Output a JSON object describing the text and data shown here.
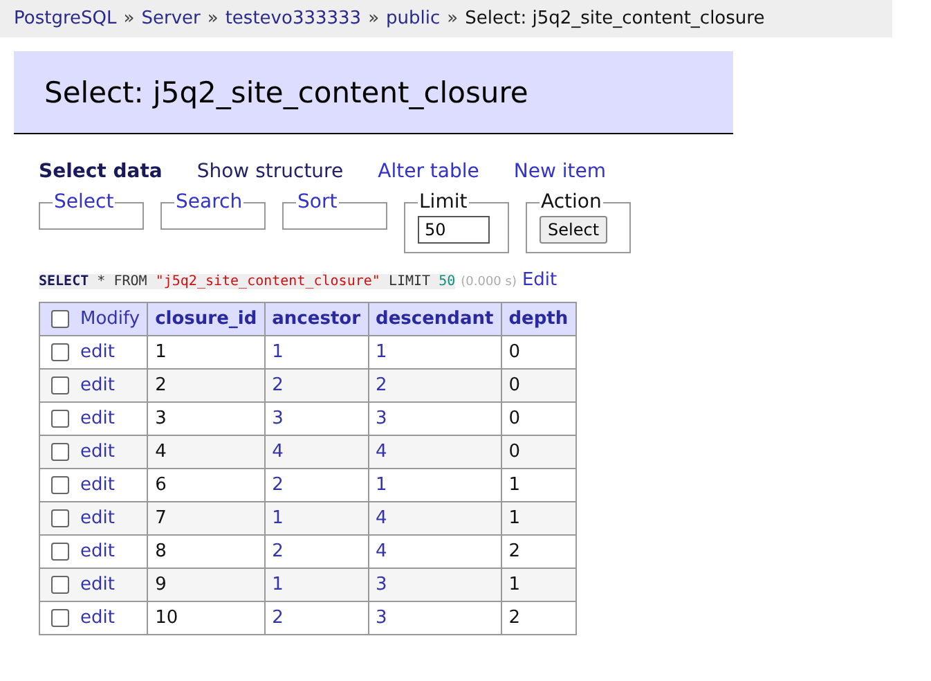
{
  "breadcrumb": [
    {
      "kind": "link",
      "text": "PostgreSQL"
    },
    {
      "kind": "separator",
      "text": "»"
    },
    {
      "kind": "link",
      "text": "Server"
    },
    {
      "kind": "separator",
      "text": "»"
    },
    {
      "kind": "link",
      "text": "testevo333333"
    },
    {
      "kind": "separator",
      "text": "»"
    },
    {
      "kind": "link",
      "text": "public"
    },
    {
      "kind": "separator",
      "text": "»"
    },
    {
      "kind": "current",
      "text": "Select: j5q2_site_content_closure"
    }
  ],
  "heading": "Select: j5q2_site_content_closure",
  "menu": [
    {
      "label": "Select data",
      "selected": true
    },
    {
      "label": "Show structure",
      "selected": false
    },
    {
      "label": "Alter table",
      "selected": false
    },
    {
      "label": "New item",
      "selected": false
    }
  ],
  "fieldsets": [
    {
      "legend": "Select",
      "kind": "empty"
    },
    {
      "legend": "Search",
      "kind": "empty"
    },
    {
      "legend": "Sort",
      "kind": "empty"
    },
    {
      "legend": "Limit",
      "kind": "input",
      "value": "50"
    },
    {
      "legend": "Action",
      "kind": "button",
      "button": "Select"
    }
  ],
  "query": {
    "parts": [
      {
        "kind": "keyword",
        "text": "SELECT"
      },
      {
        "kind": "plain",
        "text": "*"
      },
      {
        "kind": "plain",
        "text": "FROM"
      },
      {
        "kind": "string",
        "text": "\"j5q2_site_content_closure\""
      },
      {
        "kind": "plain",
        "text": "LIMIT"
      },
      {
        "kind": "number",
        "text": "50"
      }
    ],
    "time": "(0.000 s)",
    "edit": "Edit"
  },
  "table": {
    "select_all": {
      "checked": false,
      "label": "Modify"
    },
    "columns": [
      {
        "label": "closure_id",
        "link": false
      },
      {
        "label": "ancestor",
        "link": true
      },
      {
        "label": "descendant",
        "link": true
      },
      {
        "label": "depth",
        "link": false
      }
    ],
    "rows": [
      {
        "checked": false,
        "action": "edit",
        "cells": [
          "1",
          "1",
          "1",
          "0"
        ]
      },
      {
        "checked": false,
        "action": "edit",
        "cells": [
          "2",
          "2",
          "2",
          "0"
        ]
      },
      {
        "checked": false,
        "action": "edit",
        "cells": [
          "3",
          "3",
          "3",
          "0"
        ]
      },
      {
        "checked": false,
        "action": "edit",
        "cells": [
          "4",
          "4",
          "4",
          "0"
        ]
      },
      {
        "checked": false,
        "action": "edit",
        "cells": [
          "6",
          "2",
          "1",
          "1"
        ]
      },
      {
        "checked": false,
        "action": "edit",
        "cells": [
          "7",
          "1",
          "4",
          "1"
        ]
      },
      {
        "checked": false,
        "action": "edit",
        "cells": [
          "8",
          "2",
          "4",
          "2"
        ]
      },
      {
        "checked": false,
        "action": "edit",
        "cells": [
          "9",
          "1",
          "3",
          "1"
        ]
      },
      {
        "checked": false,
        "action": "edit",
        "cells": [
          "10",
          "2",
          "3",
          "2"
        ]
      }
    ]
  }
}
